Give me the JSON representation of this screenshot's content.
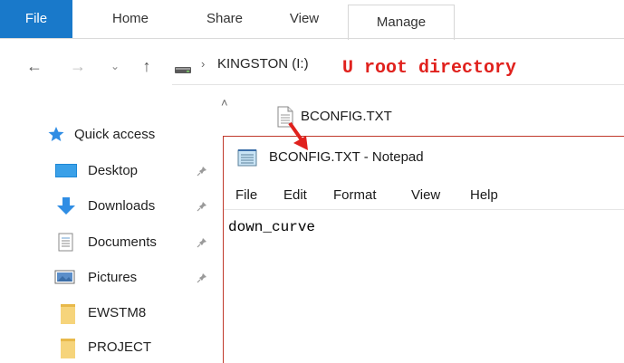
{
  "ribbon": {
    "tabs": [
      "File",
      "Home",
      "Share",
      "View",
      "Manage"
    ]
  },
  "address": {
    "path": "KINGSTON (I:)",
    "annotation": "U root directory"
  },
  "sidebar": {
    "items": [
      {
        "label": "Quick access",
        "icon": "star-icon"
      },
      {
        "label": "Desktop",
        "icon": "desktop-icon"
      },
      {
        "label": "Downloads",
        "icon": "download-icon"
      },
      {
        "label": "Documents",
        "icon": "documents-icon"
      },
      {
        "label": "Pictures",
        "icon": "pictures-icon"
      },
      {
        "label": "EWSTM8",
        "icon": "folder-icon"
      },
      {
        "label": "PROJECT",
        "icon": "folder-icon"
      }
    ]
  },
  "file_item": {
    "name": "BCONFIG.TXT"
  },
  "notepad": {
    "title": "BCONFIG.TXT - Notepad",
    "menu": [
      "File",
      "Edit",
      "Format",
      "View",
      "Help"
    ],
    "content": "down_curve"
  },
  "colors": {
    "file_tab": "#1979ca",
    "annotation": "#e0211d",
    "arrow": "#e0211d"
  }
}
